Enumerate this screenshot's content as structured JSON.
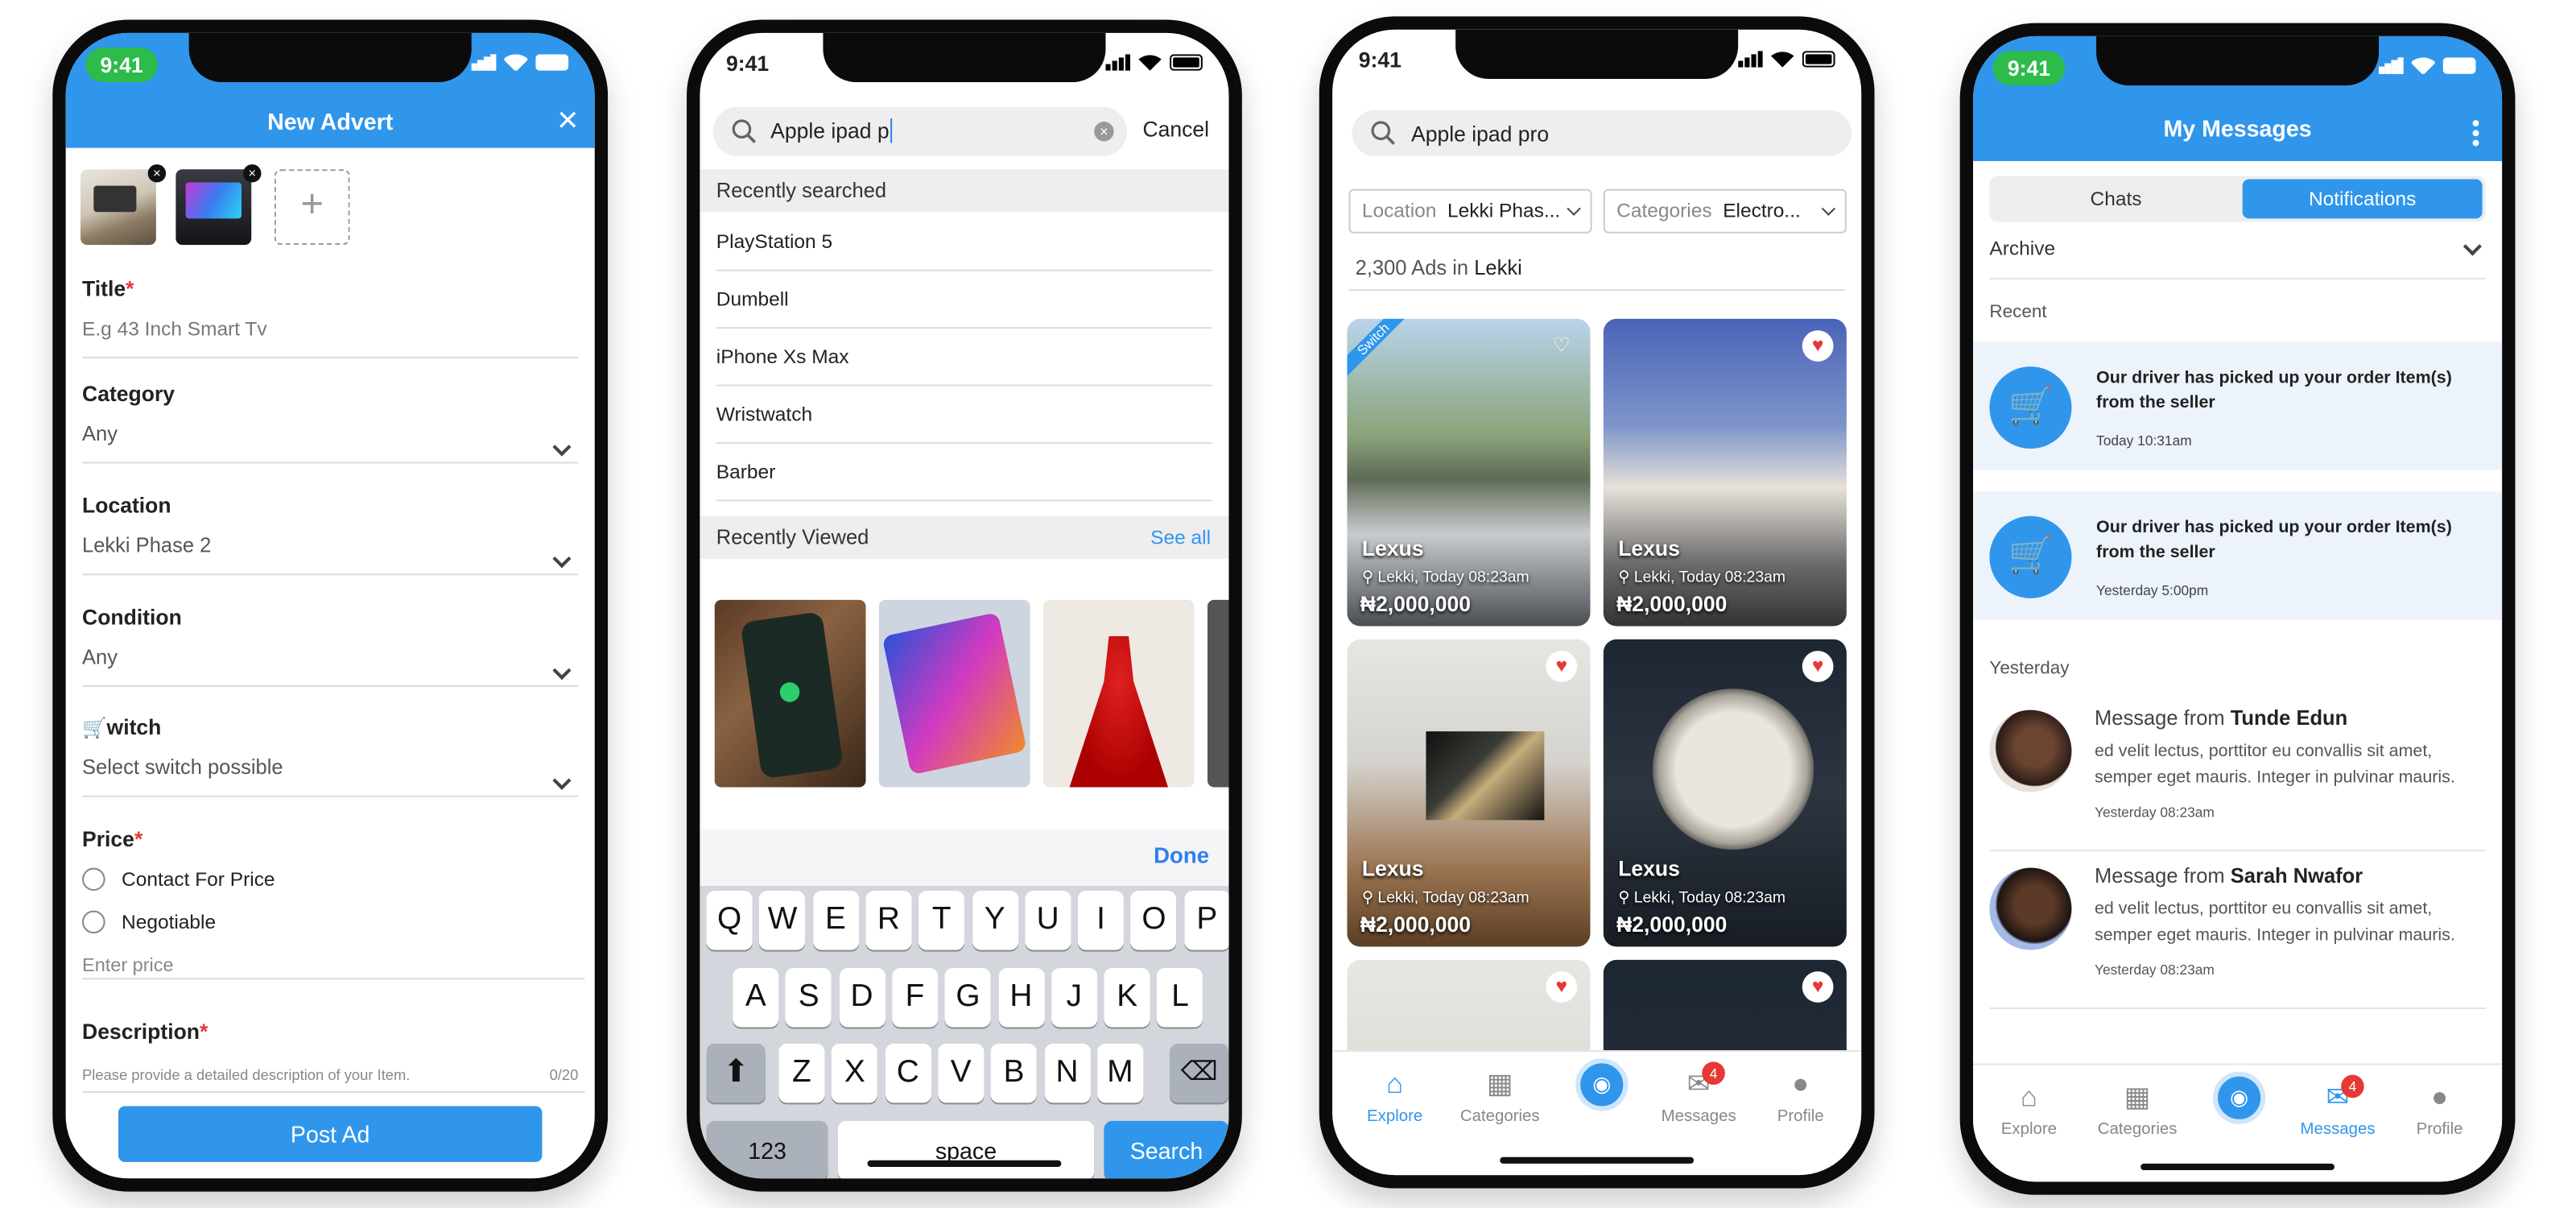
{
  "status": {
    "time": "9:41"
  },
  "advert": {
    "title": "New Advert",
    "close_icon": "×",
    "fields": {
      "title_label": "Title",
      "title_placeholder": "E.g  43 Inch Smart Tv",
      "category_label": "Category",
      "category_value": "Any",
      "location_label": "Location",
      "location_value": "Lekki Phase 2",
      "condition_label": "Condition",
      "condition_value": "Any",
      "switch_label": "witch",
      "switch_value": "Select switch possible",
      "price_label": "Price",
      "price_opt1": "Contact For Price",
      "price_opt2": "Negotiable",
      "price_placeholder": "Enter price",
      "description_label": "Description",
      "description_placeholder": "Please provide a detailed description of your Item.",
      "description_count": "0/20"
    },
    "post_button": "Post Ad"
  },
  "search": {
    "query": "Apple ipad p",
    "cancel": "Cancel",
    "recent_header": "Recently searched",
    "recent": [
      "PlayStation 5",
      "Dumbell",
      "iPhone Xs Max",
      "Wristwatch",
      "Barber"
    ],
    "viewed_header": "Recently Viewed",
    "see_all": "See all",
    "done": "Done",
    "keys_row1": [
      "Q",
      "W",
      "E",
      "R",
      "T",
      "Y",
      "U",
      "I",
      "O",
      "P"
    ],
    "keys_row2": [
      "A",
      "S",
      "D",
      "F",
      "G",
      "H",
      "J",
      "K",
      "L"
    ],
    "keys_row3": [
      "Z",
      "X",
      "C",
      "V",
      "B",
      "N",
      "M"
    ],
    "key_123": "123",
    "key_space": "space",
    "key_search": "Search"
  },
  "explore": {
    "query": "Apple ipad pro",
    "filter_location_label": "Location",
    "filter_location_value": "Lekki Phas...",
    "filter_category_label": "Categories",
    "filter_category_value": "Electro...",
    "count_text": "2,300 Ads in",
    "count_place": "Lekki",
    "switch_ribbon": "Switch",
    "cards": [
      {
        "name": "Lexus",
        "loc": "Lekki, Today 08:23am",
        "price": "₦2,000,000"
      },
      {
        "name": "Lexus",
        "loc": "Lekki, Today 08:23am",
        "price": "₦2,000,000"
      },
      {
        "name": "Lexus",
        "loc": "Lekki, Today 08:23am",
        "price": "₦2,000,000"
      },
      {
        "name": "Lexus",
        "loc": "Lekki, Today 08:23am",
        "price": "₦2,000,000"
      }
    ]
  },
  "tabs": {
    "explore": "Explore",
    "categories": "Categories",
    "messages": "Messages",
    "profile": "Profile",
    "badge": "4"
  },
  "messages": {
    "title": "My Messages",
    "seg_chats": "Chats",
    "seg_notifications": "Notifications",
    "archive": "Archive",
    "recent": "Recent",
    "yesterday": "Yesterday",
    "notifications": [
      {
        "text": "Our driver has picked up your order Item(s) from the seller",
        "time": "Today 10:31am"
      },
      {
        "text": "Our driver has picked up your order Item(s) from the seller",
        "time": "Yesterday 5:00pm"
      }
    ],
    "items": [
      {
        "from_prefix": "Message from ",
        "from": "Tunde Edun",
        "body": "ed velit lectus, porttitor eu convallis sit amet, semper eget mauris. Integer in pulvinar mauris.",
        "time": "Yesterday 08:23am"
      },
      {
        "from_prefix": "Message from ",
        "from": "Sarah Nwafor",
        "body": "ed velit lectus, porttitor eu convallis sit amet, semper eget mauris. Integer in pulvinar mauris.",
        "time": "Yesterday 08:23am"
      }
    ]
  },
  "colors": {
    "accent": "#2f96ec",
    "badge": "#e53935",
    "status_pill": "#2dbb4a"
  }
}
